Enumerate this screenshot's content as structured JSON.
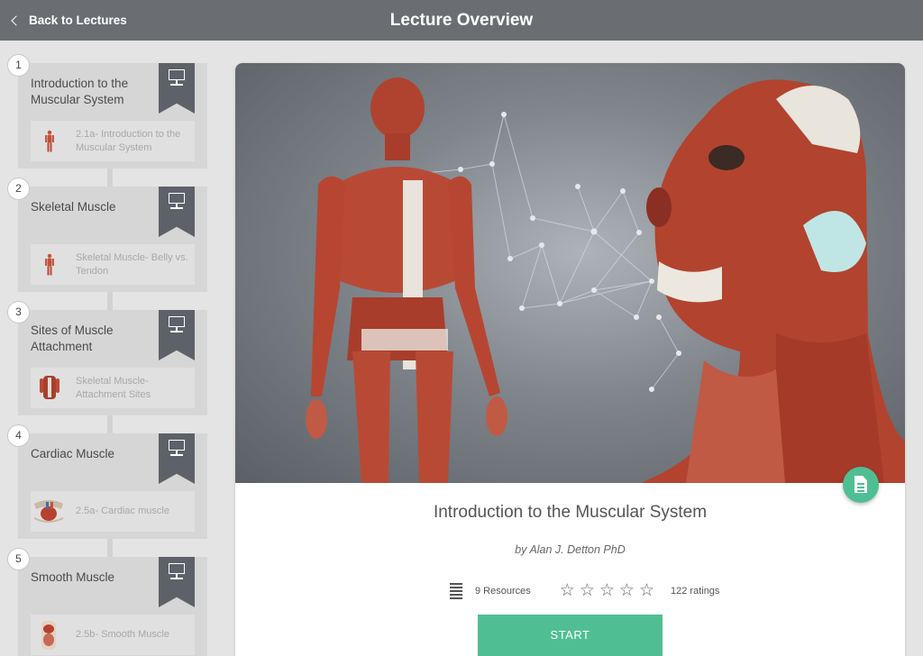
{
  "header": {
    "back_label": "Back to Lectures",
    "title": "Lecture Overview"
  },
  "lectures": [
    {
      "number": "1",
      "title": "Introduction to the Muscular System",
      "resource": "2.1a- Introduction to the Muscular System"
    },
    {
      "number": "2",
      "title": "Skeletal Muscle",
      "resource": "Skeletal Muscle- Belly vs. Tendon"
    },
    {
      "number": "3",
      "title": "Sites of Muscle Attachment",
      "resource": "Skeletal Muscle- Attachment Sites"
    },
    {
      "number": "4",
      "title": "Cardiac Muscle",
      "resource": "2.5a- Cardiac muscle"
    },
    {
      "number": "5",
      "title": "Smooth Muscle",
      "resource": "2.5b- Smooth Muscle"
    }
  ],
  "card": {
    "title": "Introduction to the Muscular System",
    "author": "by Alan J. Detton PhD",
    "resources": "9 Resources",
    "stars": "☆",
    "ratings": "122 ratings",
    "start_label": "START"
  },
  "colors": {
    "header": "#6a6e73",
    "accent": "#4fbf93",
    "ribbon": "#5d6268"
  }
}
